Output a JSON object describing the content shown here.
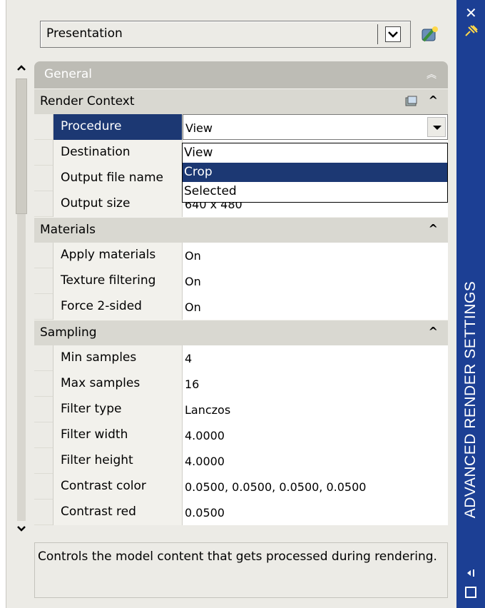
{
  "window": {
    "title": "ADVANCED RENDER SETTINGS"
  },
  "preset": {
    "selected": "Presentation"
  },
  "general": {
    "label": "General"
  },
  "sections": {
    "render_context": {
      "label": "Render Context",
      "rows": [
        {
          "name": "Procedure",
          "value": "View"
        },
        {
          "name": "Destination",
          "value": ""
        },
        {
          "name": "Output file name",
          "value": ""
        },
        {
          "name": "Output size",
          "value": "640 x 480"
        }
      ]
    },
    "materials": {
      "label": "Materials",
      "rows": [
        {
          "name": "Apply materials",
          "value": "On"
        },
        {
          "name": "Texture filtering",
          "value": "On"
        },
        {
          "name": "Force 2-sided",
          "value": "On"
        }
      ]
    },
    "sampling": {
      "label": "Sampling",
      "rows": [
        {
          "name": "Min samples",
          "value": "4"
        },
        {
          "name": "Max samples",
          "value": "16"
        },
        {
          "name": "Filter type",
          "value": "Lanczos"
        },
        {
          "name": "Filter width",
          "value": "4.0000"
        },
        {
          "name": "Filter height",
          "value": "4.0000"
        },
        {
          "name": "Contrast color",
          "value": "0.0500, 0.0500, 0.0500, 0.0500"
        },
        {
          "name": "Contrast red",
          "value": "0.0500"
        }
      ]
    }
  },
  "procedure_dropdown": {
    "options": [
      "View",
      "Crop",
      "Selected"
    ],
    "highlighted": "Crop"
  },
  "description": "Controls the model content that gets processed during rendering.",
  "colors": {
    "titlebar": "#1c3f94",
    "selection": "#1c3873",
    "panel": "#ecebe6"
  }
}
